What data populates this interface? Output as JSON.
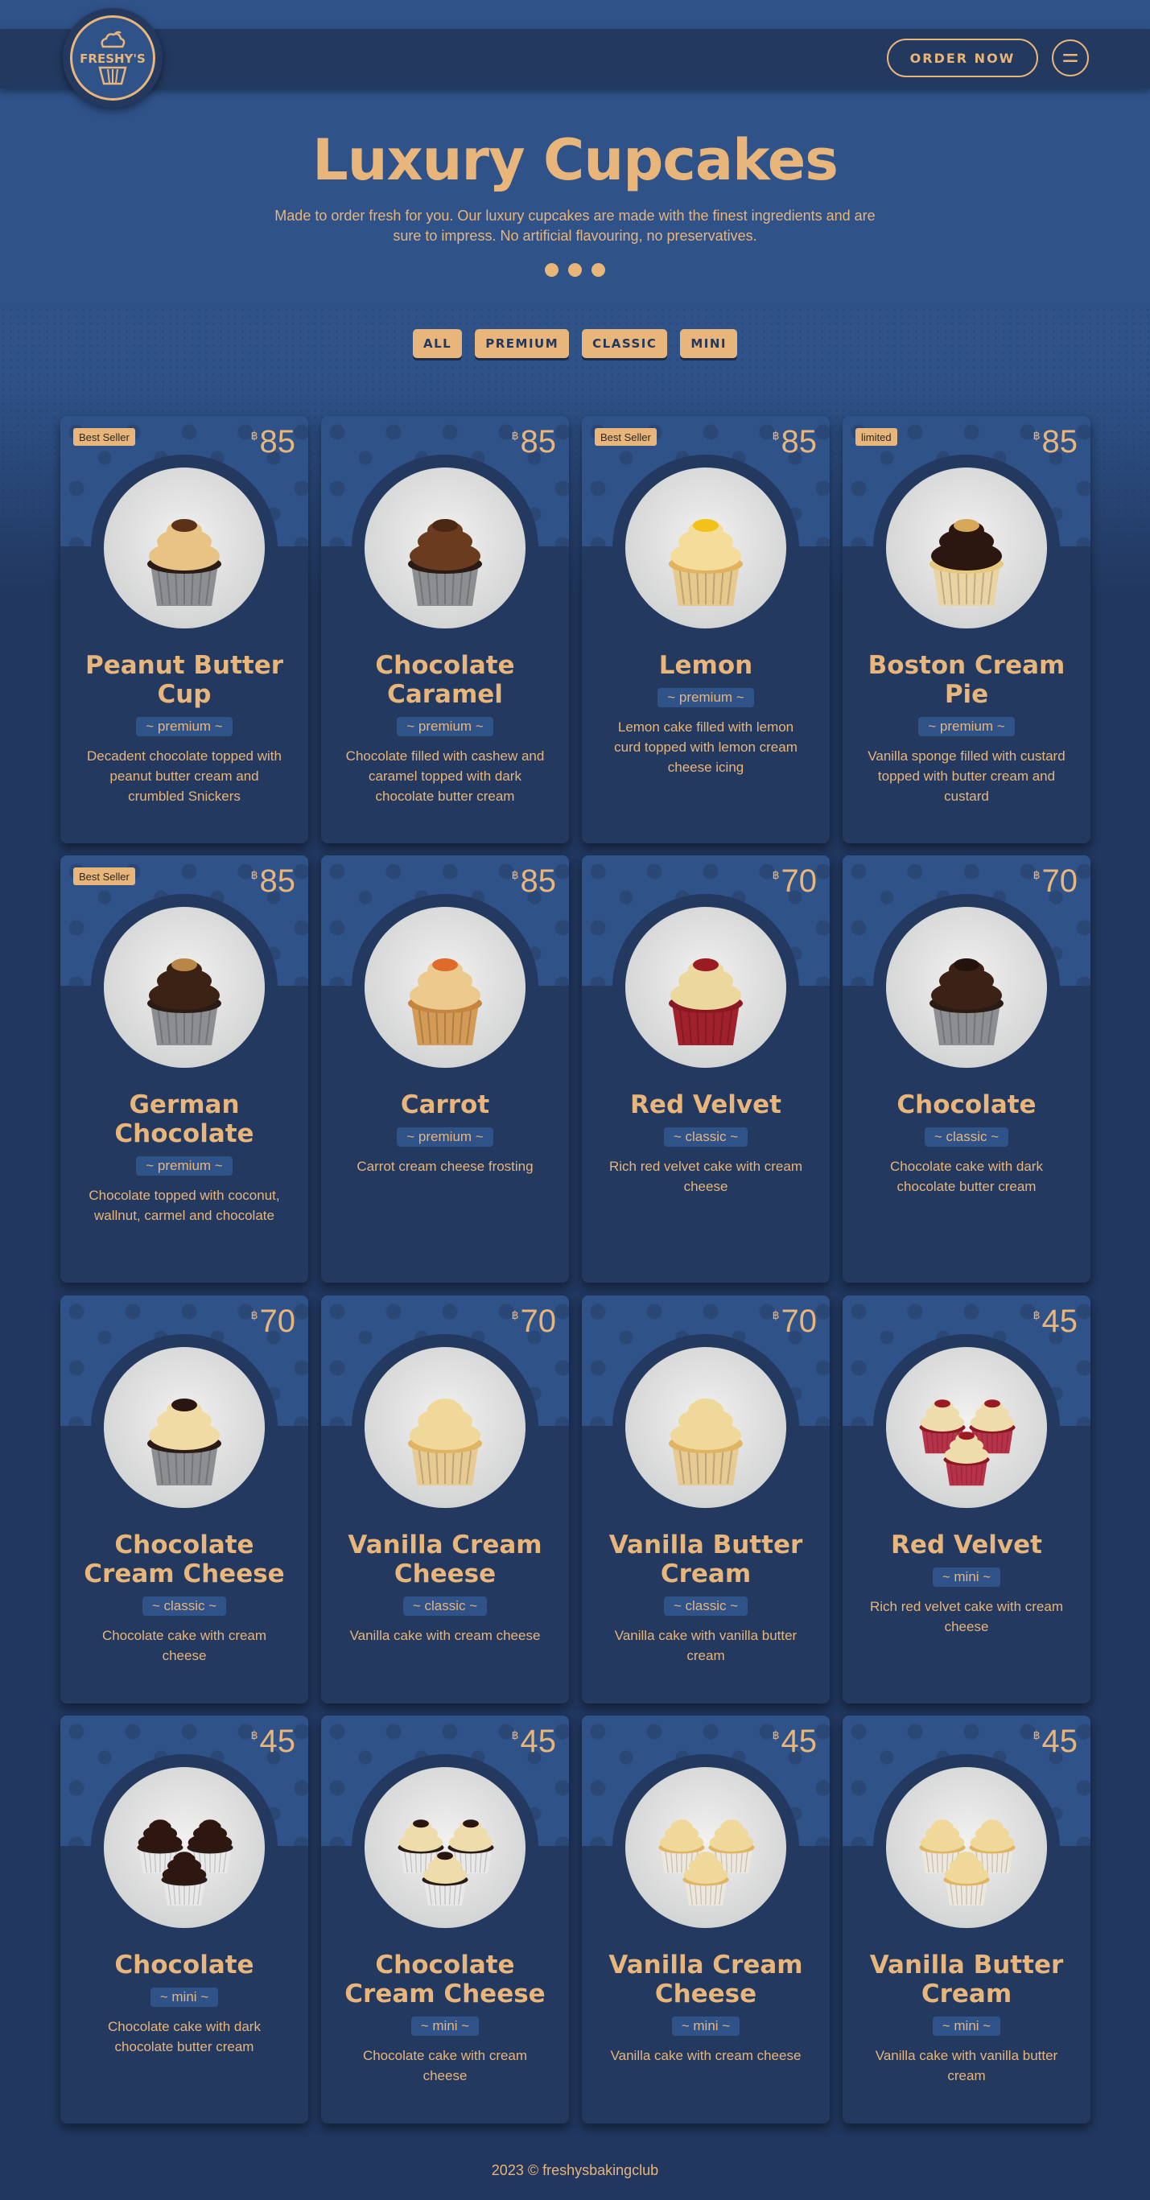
{
  "header": {
    "logo_text": "FRESHY'S",
    "order_button": "ORDER NOW"
  },
  "hero": {
    "title": "Luxury Cupcakes",
    "subtitle": "Made to order fresh for you. Our luxury cupcakes are made with the finest ingredients and are sure to impress. No artificial flavouring, no preservatives."
  },
  "filters": [
    "ALL",
    "PREMIUM",
    "CLASSIC",
    "MINI"
  ],
  "currency_symbol": "฿",
  "products": [
    {
      "name": "Peanut Butter Cup",
      "tag": "~ premium ~",
      "price": "85",
      "badge": "Best Seller",
      "description": "Decadent chocolate topped with peanut butter cream and crumbled Snickers",
      "frosting": "#e9c383",
      "topping": "#5b3218",
      "cake": "#2a1b14",
      "liner": "#8d8e92",
      "count": 1
    },
    {
      "name": "Chocolate Caramel",
      "tag": "~ premium ~",
      "price": "85",
      "badge": "",
      "description": "Chocolate filled with cashew and caramel topped with dark chocolate butter cream",
      "frosting": "#6a3b1f",
      "topping": "#4a2812",
      "cake": "#2a1b14",
      "liner": "#8d8e92",
      "count": 1
    },
    {
      "name": "Lemon",
      "tag": "~ premium ~",
      "price": "85",
      "badge": "Best Seller",
      "description": "Lemon cake filled with lemon curd topped with lemon cream cheese icing",
      "frosting": "#f4dd9a",
      "topping": "#f1c21a",
      "cake": "#e2b25e",
      "liner": "#e6c98d",
      "count": 1
    },
    {
      "name": "Boston Cream Pie",
      "tag": "~ premium ~",
      "price": "85",
      "badge": "limited",
      "description": "Vanilla sponge filled with custard topped with butter cream and custard",
      "frosting": "#2b1610",
      "topping": "#d7a85a",
      "cake": "#e7c87f",
      "liner": "#ead4a4",
      "count": 1
    },
    {
      "name": "German Chocolate",
      "tag": "~ premium ~",
      "price": "85",
      "badge": "Best Seller",
      "description": "Chocolate topped with coconut, wallnut, carmel and chocolate",
      "frosting": "#3b2214",
      "topping": "#b98648",
      "cake": "#2a1b14",
      "liner": "#8d8e92",
      "count": 1
    },
    {
      "name": "Carrot",
      "tag": "~ premium ~",
      "price": "85",
      "badge": "",
      "description": "Carrot cream cheese frosting",
      "frosting": "#ecc98c",
      "topping": "#e06a2a",
      "cake": "#c6843e",
      "liner": "#d39b56",
      "count": 1
    },
    {
      "name": "Red Velvet",
      "tag": "~ classic ~",
      "price": "70",
      "badge": "",
      "description": "Rich red velvet cake with cream cheese",
      "frosting": "#ecd79d",
      "topping": "#9a1c22",
      "cake": "#8a1822",
      "liner": "#a0202c",
      "count": 1
    },
    {
      "name": "Chocolate",
      "tag": "~ classic ~",
      "price": "70",
      "badge": "",
      "description": "Chocolate cake with dark chocolate butter cream",
      "frosting": "#3b2116",
      "topping": "#24130d",
      "cake": "#2a1b14",
      "liner": "#8d8e92",
      "count": 1
    },
    {
      "name": "Chocolate Cream Cheese",
      "tag": "~ classic ~",
      "price": "70",
      "badge": "",
      "description": "Chocolate cake with cream cheese",
      "frosting": "#efdba3",
      "topping": "#2a1610",
      "cake": "#2a1b14",
      "liner": "#8d8e92",
      "count": 1
    },
    {
      "name": "Vanilla Cream Cheese",
      "tag": "~ classic ~",
      "price": "70",
      "badge": "",
      "description": "Vanilla cake with cream cheese",
      "frosting": "#efd89a",
      "topping": "#efd89a",
      "cake": "#e0b462",
      "liner": "#e7cb92",
      "count": 1
    },
    {
      "name": "Vanilla Butter Cream",
      "tag": "~ classic ~",
      "price": "70",
      "badge": "",
      "description": "Vanilla cake with vanilla butter cream",
      "frosting": "#efd89a",
      "topping": "#efd89a",
      "cake": "#e0b462",
      "liner": "#e7cb92",
      "count": 1
    },
    {
      "name": "Red Velvet",
      "tag": "~ mini ~",
      "price": "45",
      "badge": "",
      "description": "Rich red velvet cake with cream cheese",
      "frosting": "#efdcab",
      "topping": "#9a1c22",
      "cake": "#8a1822",
      "liner": "#b8324a",
      "count": 3
    },
    {
      "name": "Chocolate",
      "tag": "~ mini ~",
      "price": "45",
      "badge": "",
      "description": "Chocolate cake with dark chocolate butter cream",
      "frosting": "#2e1710",
      "topping": "#2e1710",
      "cake": "#2a1b14",
      "liner": "#e9e9ea",
      "count": 3
    },
    {
      "name": "Chocolate Cream Cheese",
      "tag": "~ mini ~",
      "price": "45",
      "badge": "",
      "description": "Chocolate cake with cream cheese",
      "frosting": "#efdcab",
      "topping": "#2a1610",
      "cake": "#2a1b14",
      "liner": "#e9e9ea",
      "count": 3
    },
    {
      "name": "Vanilla Cream Cheese",
      "tag": "~ mini ~",
      "price": "45",
      "badge": "",
      "description": "Vanilla cake with cream cheese",
      "frosting": "#efd89a",
      "topping": "#efd89a",
      "cake": "#e0b462",
      "liner": "#eee8dc",
      "count": 3
    },
    {
      "name": "Vanilla Butter Cream",
      "tag": "~ mini ~",
      "price": "45",
      "badge": "",
      "description": "Vanilla cake with vanilla butter cream",
      "frosting": "#efd89a",
      "topping": "#efd89a",
      "cake": "#e0b462",
      "liner": "#eee8dc",
      "count": 3
    }
  ],
  "footer": "2023 © freshysbakingclub",
  "colors": {
    "primary": "#2f5289",
    "dark": "#23395f",
    "accent": "#e8b57a"
  }
}
